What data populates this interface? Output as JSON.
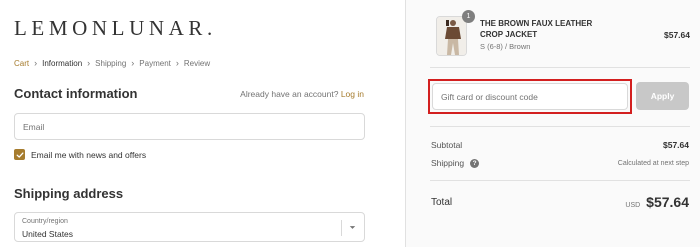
{
  "brand": {
    "logo_text": "LEMONLUNAR."
  },
  "breadcrumb": {
    "items": [
      "Cart",
      "Information",
      "Shipping",
      "Payment",
      "Review"
    ]
  },
  "contact": {
    "title": "Contact information",
    "account_prompt": "Already have an account?",
    "login_link": "Log in",
    "email_placeholder": "Email",
    "newsletter_label": "Email me with news and offers",
    "newsletter_checked": true
  },
  "shipping": {
    "title": "Shipping address",
    "country_label": "Country/region",
    "country_value": "United States"
  },
  "product": {
    "quantity": "1",
    "name": "THE BROWN FAUX LEATHER CROP JACKET",
    "variant": "S (6-8) / Brown",
    "price": "$57.64"
  },
  "discount": {
    "placeholder": "Gift card or discount code",
    "apply_label": "Apply"
  },
  "summary": {
    "subtotal_label": "Subtotal",
    "subtotal_value": "$57.64",
    "shipping_label": "Shipping",
    "shipping_value": "Calculated at next step",
    "total_label": "Total",
    "currency": "USD",
    "total_value": "$57.64"
  },
  "colors": {
    "accent": "#a67c2e",
    "highlight": "#d31f1f",
    "apply_disabled": "#c8c8c8"
  }
}
